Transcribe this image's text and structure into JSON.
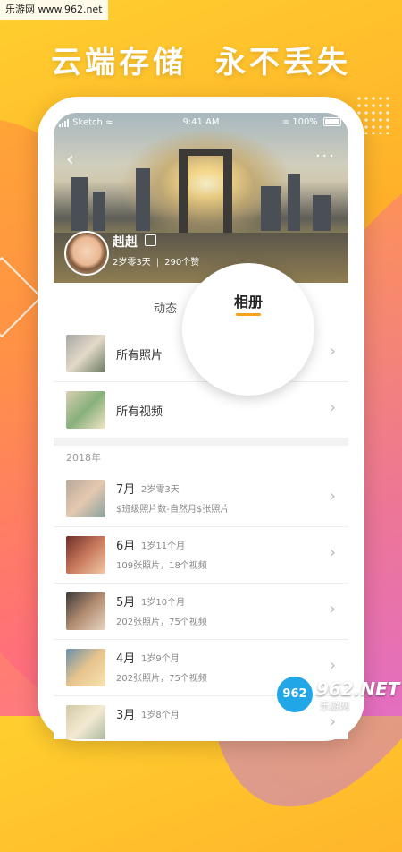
{
  "watermark_top": "乐游网 www.962.net",
  "headline": {
    "part1": "云端存储",
    "part2": "永不丢失"
  },
  "status_bar": {
    "carrier": "Sketch",
    "time": "9:41 AM",
    "battery": "100%"
  },
  "profile": {
    "name": "赳赳",
    "age": "2岁零3天",
    "count": "290个赞"
  },
  "tabs": {
    "activity": "动态",
    "album": "相册"
  },
  "albums": [
    {
      "title": "所有照片"
    },
    {
      "title": "所有视频"
    }
  ],
  "year": "2018年",
  "months": [
    {
      "month": "7月",
      "age": "2岁零3天",
      "count": "$班级照片数-自然月$张照片"
    },
    {
      "month": "6月",
      "age": "1岁11个月",
      "count": "109张照片，18个视频"
    },
    {
      "month": "5月",
      "age": "1岁10个月",
      "count": "202张照片，75个视频"
    },
    {
      "month": "4月",
      "age": "1岁9个月",
      "count": "202张照片，75个视频"
    },
    {
      "month": "3月",
      "age": "1岁8个月",
      "count": ""
    }
  ],
  "watermark_bottom": {
    "logo": "962",
    "main": "962.NET",
    "sub": "乐游网"
  },
  "colors": {
    "accent": "#f7a21b",
    "background_top": "#ffcf2e",
    "background_bottom": "#ff6fa0"
  }
}
